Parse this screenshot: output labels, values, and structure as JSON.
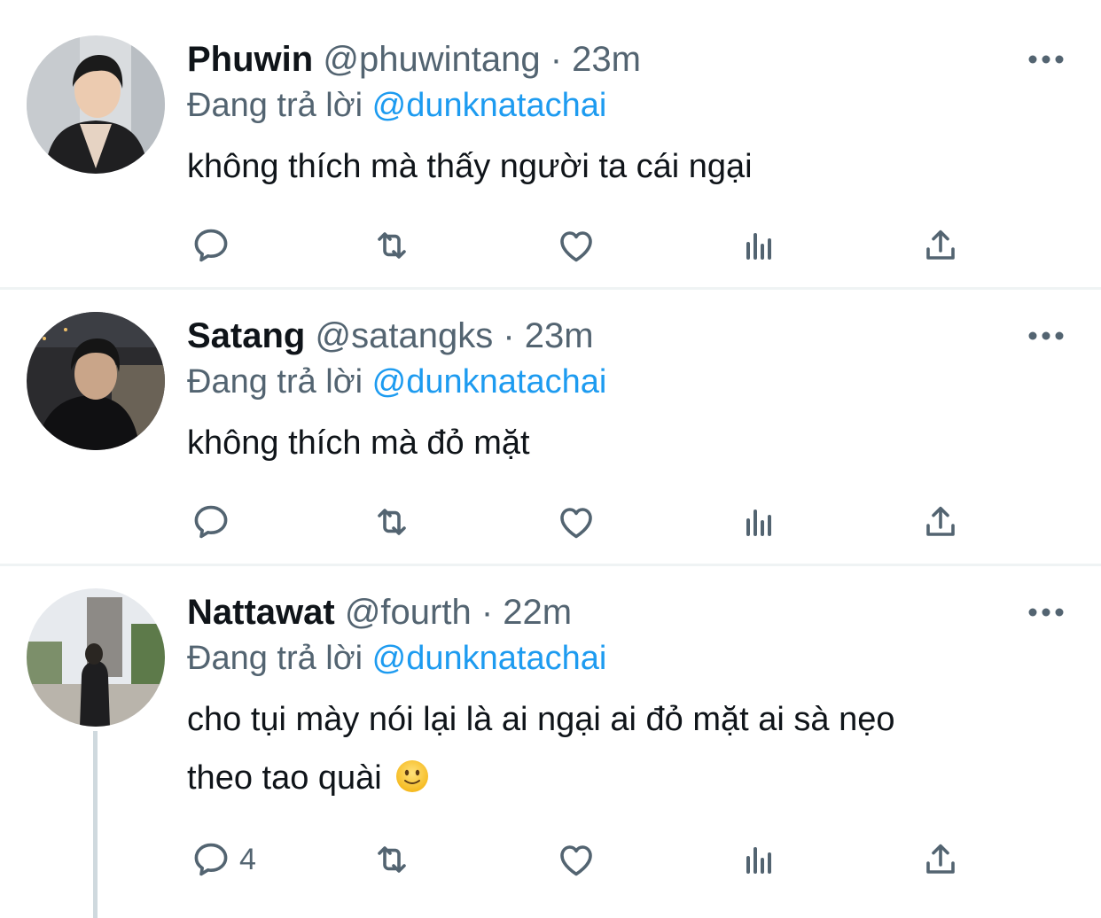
{
  "tweets": [
    {
      "name": "Phuwin",
      "handle": "@phuwintang",
      "time": "23m",
      "reply_prefix": "Đang trả lời",
      "reply_to": "@dunknatachai",
      "text": "không thích mà thấy người ta cái ngại",
      "reply_count": ""
    },
    {
      "name": "Satang",
      "handle": "@satangks",
      "time": "23m",
      "reply_prefix": "Đang trả lời",
      "reply_to": "@dunknatachai",
      "text": "không thích mà đỏ mặt",
      "reply_count": ""
    },
    {
      "name": "Nattawat",
      "handle": "@fourth",
      "time": "22m",
      "reply_prefix": "Đang trả lời",
      "reply_to": "@dunknatachai",
      "text_line1": "cho tụi mày nói lại là ai ngại ai đỏ mặt ai sà nẹo",
      "text_line2": "theo tao quài",
      "emoji": "slightly-smiling-face",
      "reply_count": "4"
    }
  ],
  "separator": "·",
  "icons": [
    "reply-icon",
    "retweet-icon",
    "like-icon",
    "analytics-icon",
    "share-icon",
    "more-icon"
  ],
  "colors": {
    "accent": "#1d9bf0",
    "secondary_text": "#536471",
    "divider": "#eff3f4"
  }
}
